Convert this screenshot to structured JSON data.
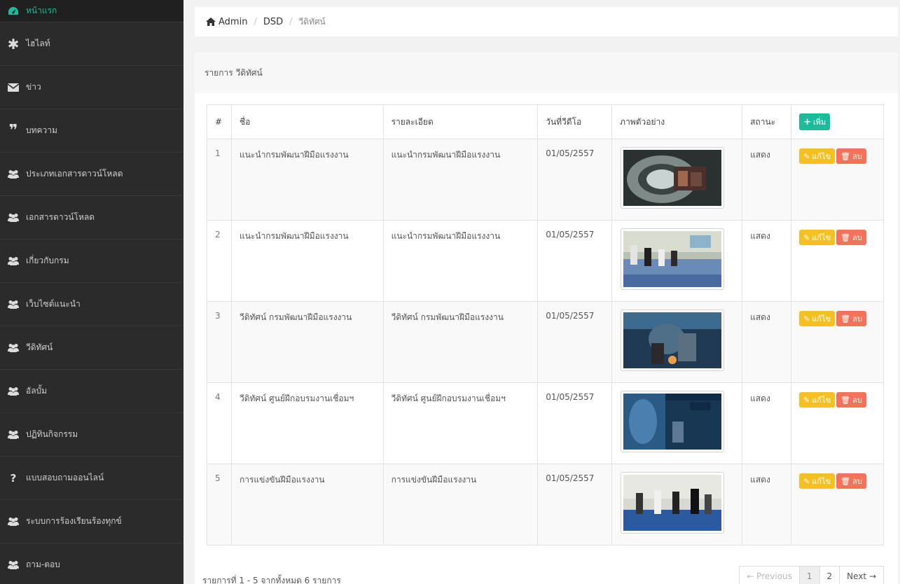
{
  "sidebar": {
    "items": [
      {
        "label": "หน้าแรก",
        "icon": "dashboard-icon",
        "active": true
      },
      {
        "label": "ไฮไลท์",
        "icon": "asterisk-icon"
      },
      {
        "label": "ข่าว",
        "icon": "envelope-icon"
      },
      {
        "label": "บทความ",
        "icon": "quote-icon"
      },
      {
        "label": "ประเภทเอกสารดาวน์โหลด",
        "icon": "users-icon"
      },
      {
        "label": "เอกสารดาวน์โหลด",
        "icon": "users-icon"
      },
      {
        "label": "เกี่ยวกับกรม",
        "icon": "users-icon"
      },
      {
        "label": "เว็บไซต์แนะนำ",
        "icon": "users-icon"
      },
      {
        "label": "วีดิทัศน์",
        "icon": "users-icon"
      },
      {
        "label": "อัลบั้ม",
        "icon": "users-icon"
      },
      {
        "label": "ปฏิทินกิจกรรม",
        "icon": "users-icon"
      },
      {
        "label": "แบบสอบถามออนไลน์",
        "icon": "question-icon"
      },
      {
        "label": "ระบบการร้องเรียนร้องทุกข์",
        "icon": "users-icon"
      },
      {
        "label": "ถาม-ตอบ",
        "icon": "users-icon"
      }
    ]
  },
  "breadcrumb": {
    "icon": "home-icon",
    "items": [
      "Admin",
      "DSD",
      "วีดิทัศน์"
    ]
  },
  "panel": {
    "title": "รายการ วีดิทัศน์"
  },
  "table": {
    "headers": {
      "num": "#",
      "name": "ชื่อ",
      "detail": "รายละเอียด",
      "date": "วันที่วีดีโอ",
      "preview": "ภาพตัวอย่าง",
      "status": "สถานะ",
      "add_button": "เพิ่ม"
    },
    "rows": [
      {
        "num": "1",
        "name": "แนะนำกรมพัฒนาฝีมือแรงงาน",
        "detail": "แนะนำกรมพัฒนาฝีมือแรงงาน",
        "date": "01/05/2557",
        "status": "แสดง"
      },
      {
        "num": "2",
        "name": "แนะนำกรมพัฒนาฝีมือแรงงาน",
        "detail": "แนะนำกรมพัฒนาฝีมือแรงงาน",
        "date": "01/05/2557",
        "status": "แสดง"
      },
      {
        "num": "3",
        "name": "วีดิทัศน์ กรมพัฒนาฝีมือแรงงาน",
        "detail": "วีดิทัศน์ กรมพัฒนาฝีมือแรงงาน",
        "date": "01/05/2557",
        "status": "แสดง"
      },
      {
        "num": "4",
        "name": "วีดิทัศน์ ศูนย์ฝึกอบรมงานเชื่อมฯ",
        "detail": "วีดิทัศน์ ศูนย์ฝึกอบรมงานเชื่อมฯ",
        "date": "01/05/2557",
        "status": "แสดง"
      },
      {
        "num": "5",
        "name": "การแข่งขันฝีมือแรงงาน",
        "detail": "การแข่งขันฝีมือแรงงาน",
        "date": "01/05/2557",
        "status": "แสดง"
      }
    ],
    "edit_label": "แก้ไข",
    "delete_label": "ลบ"
  },
  "footer": {
    "info": "รายการที่ 1 - 5 จากทั้งหมด 6 รายการ"
  },
  "pagination": {
    "previous": "← Previous",
    "pages": [
      "1",
      "2"
    ],
    "current": "1",
    "next": "Next →"
  },
  "colors": {
    "sidebar_bg": "#2b2b2b",
    "accent": "#1abc9c",
    "edit": "#f6c022",
    "delete": "#f2735a"
  }
}
